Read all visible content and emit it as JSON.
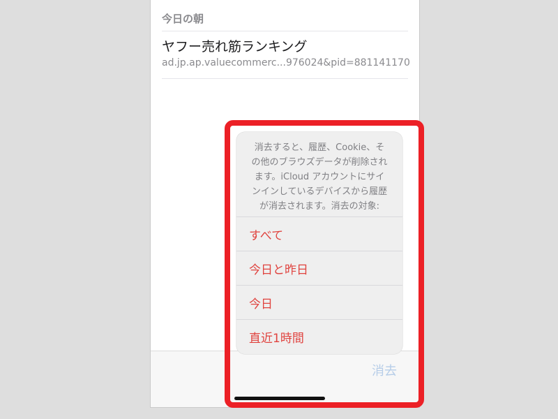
{
  "history": {
    "section_header": "今日の朝",
    "item": {
      "title": "ヤフー売れ筋ランキング",
      "url": "ad.jp.ap.valuecommerc...976024&pid=881141170"
    }
  },
  "toolbar": {
    "clear_label": "消去"
  },
  "sheet": {
    "message_lines": [
      "消去すると、履歴、Cookie、そ",
      "の他のブラウズデータが削除され",
      "ます。iCloud アカウントにサイ",
      "ンインしているデバイスから履歴",
      "が消去されます。消去の対象:"
    ],
    "options": [
      "すべて",
      "今日と昨日",
      "今日",
      "直近1時間"
    ]
  },
  "colors": {
    "destructive": "#e0433f",
    "highlight_box": "#ec2026",
    "toolbar_clear_disabled": "#b6cde8"
  }
}
